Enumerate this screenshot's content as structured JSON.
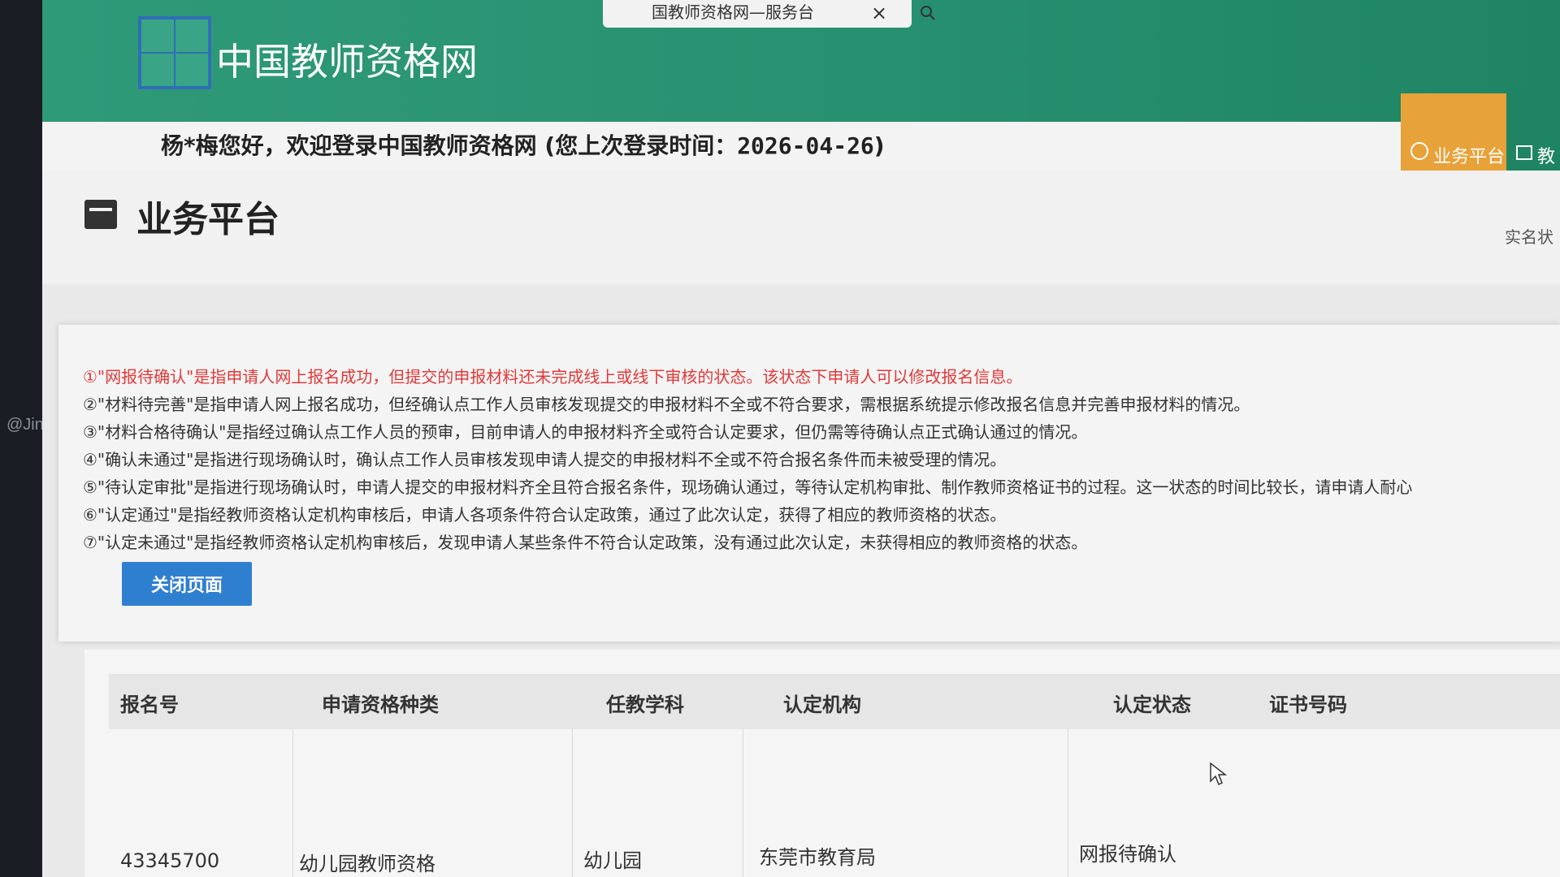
{
  "watermark": "@Jin_se",
  "browser": {
    "tab_title": "国教师资格网—服务台",
    "close_glyph": "×"
  },
  "header": {
    "site_name": "中国教师资格网",
    "nav": [
      {
        "label": "业务平台",
        "color": "#e8a23a"
      },
      {
        "label": "教",
        "color": "#1f8463"
      }
    ]
  },
  "welcome": {
    "text": "杨*梅您好，欢迎登录中国教师资格网 (您上次登录时间：",
    "date": "2026-04-26",
    "suffix": ")"
  },
  "page": {
    "title": "业务平台",
    "realname_status": "实名状"
  },
  "notes": [
    {
      "text": "①\"网报待确认\"是指申请人网上报名成功，但提交的申报材料还未完成线上或线下审核的状态。该状态下申请人可以修改报名信息。",
      "highlight": true
    },
    {
      "text": "②\"材料待完善\"是指申请人网上报名成功，但经确认点工作人员审核发现提交的申报材料不全或不符合要求，需根据系统提示修改报名信息并完善申报材料的情况。",
      "highlight": false
    },
    {
      "text": "③\"材料合格待确认\"是指经过确认点工作人员的预审，目前申请人的申报材料齐全或符合认定要求，但仍需等待确认点正式确认通过的情况。",
      "highlight": false
    },
    {
      "text": "④\"确认未通过\"是指进行现场确认时，确认点工作人员审核发现申请人提交的申报材料不全或不符合报名条件而未被受理的情况。",
      "highlight": false
    },
    {
      "text": "⑤\"待认定审批\"是指进行现场确认时，申请人提交的申报材料齐全且符合报名条件，现场确认通过，等待认定机构审批、制作教师资格证书的过程。这一状态的时间比较长，请申请人耐心",
      "highlight": false
    },
    {
      "text": "⑥\"认定通过\"是指经教师资格认定机构审核后，申请人各项条件符合认定政策，通过了此次认定，获得了相应的教师资格的状态。",
      "highlight": false
    },
    {
      "text": "⑦\"认定未通过\"是指经教师资格认定机构审核后，发现申请人某些条件不符合认定政策，没有通过此次认定，未获得相应的教师资格的状态。",
      "highlight": false
    }
  ],
  "close_button": "关闭页面",
  "table": {
    "headers": [
      "报名号",
      "申请资格种类",
      "任教学科",
      "认定机构",
      "认定状态",
      "证书号码"
    ],
    "rows": [
      [
        "43345700",
        "幼儿园教师资格",
        "幼儿园",
        "东莞市教育局",
        "网报待确认",
        ""
      ]
    ]
  },
  "colors": {
    "header_green": "#279070",
    "nav_orange": "#e8a23a",
    "note_red": "#e03a3a",
    "button_blue": "#2f7fd0"
  }
}
